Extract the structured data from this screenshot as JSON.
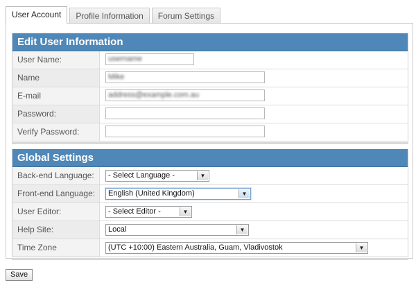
{
  "tabs": [
    {
      "label": "User Account",
      "active": true
    },
    {
      "label": "Profile Information",
      "active": false
    },
    {
      "label": "Forum Settings",
      "active": false
    }
  ],
  "edit_section": {
    "title": "Edit User Information",
    "fields": [
      {
        "label": "User Name:",
        "value": "username"
      },
      {
        "label": "Name",
        "value": "Mike"
      },
      {
        "label": "E-mail",
        "value": "address@example.com.au"
      },
      {
        "label": "Password:",
        "value": ""
      },
      {
        "label": "Verify Password:",
        "value": ""
      }
    ]
  },
  "global_section": {
    "title": "Global Settings",
    "fields": [
      {
        "label": "Back-end Language:",
        "selected": "- Select Language -"
      },
      {
        "label": "Front-end Language:",
        "selected": "English (United Kingdom)"
      },
      {
        "label": "User Editor:",
        "selected": "- Select Editor -"
      },
      {
        "label": "Help Site:",
        "selected": "Local"
      },
      {
        "label": "Time Zone",
        "selected": "(UTC +10:00) Eastern Australia, Guam, Vladivostok"
      }
    ]
  },
  "save_label": "Save",
  "colors": {
    "section_header": "#4f88b8",
    "select_highlight": "#6f9fd0"
  }
}
